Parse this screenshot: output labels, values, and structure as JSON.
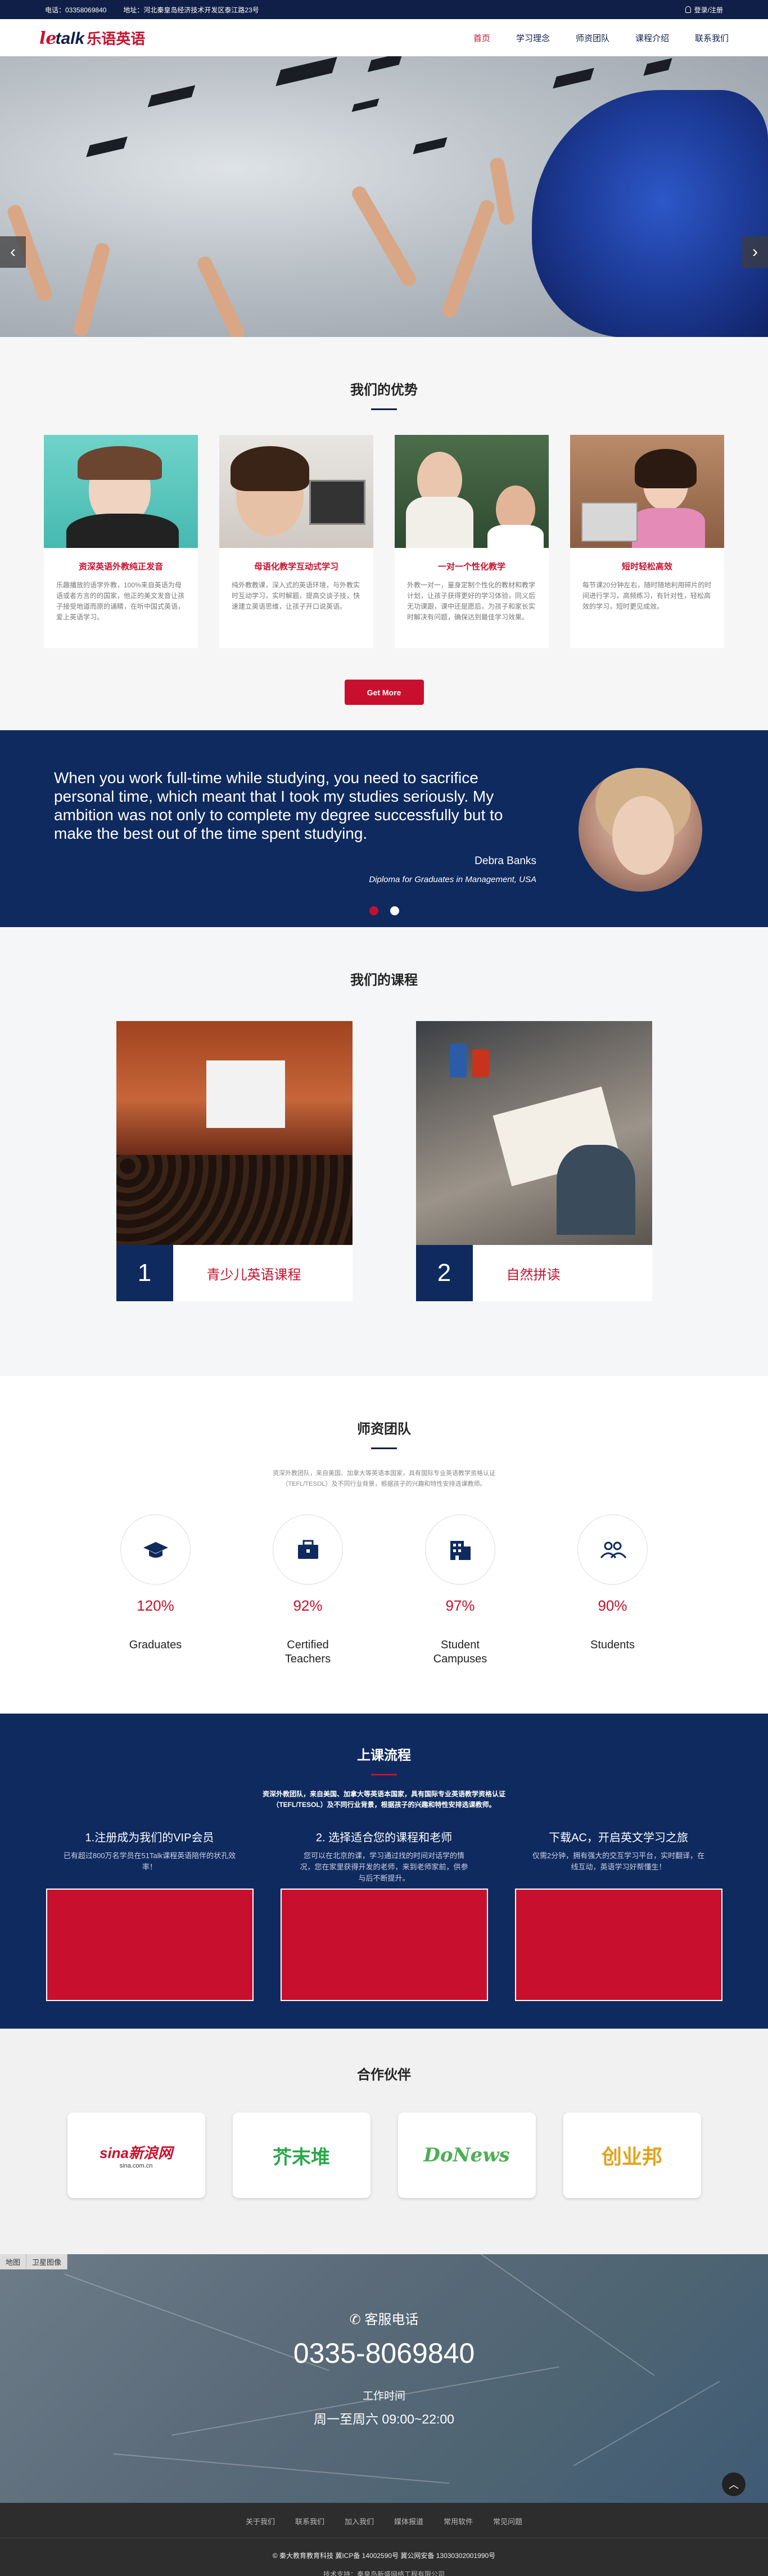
{
  "topbar": {
    "phone": "电话：03358069840",
    "address": "地址：河北秦皇岛经济技术开发区泰江路23号",
    "login": "登录/注册"
  },
  "logo": {
    "part1": "le",
    "part2": "talk",
    "cn": "乐语英语"
  },
  "nav": [
    "首页",
    "学习理念",
    "师资团队",
    "课程介绍",
    "联系我们"
  ],
  "advantages": {
    "title": "我们的优势",
    "cards": [
      {
        "title": "资深英语外教纯正发音",
        "text": "乐趣播放的语学外教，100%来自英语为母语或者方言的的国家，他正的美文发音让孩子接受地道而原的诵睛，在听中国式英语，爱上英语学习。"
      },
      {
        "title": "母语化教学互动式学习",
        "text": "纯外教教课，深入式的英语环境，与外教实时互动学习，实时解题，提高交谈子技，快速建立英语思维，让孩子开口说英语。"
      },
      {
        "title": "一对一个性化教学",
        "text": "外教一对一，量身定制个性化的教材和教学计划，让孩子获得更好的学习体验，同义后无功课跟，课中还是愿后，为孩子和家长实时解决有问题，确保达到最佳学习效果。"
      },
      {
        "title": "短时轻松高效",
        "text": "每节课20分钟左右，随时随地利用碎片的时间进行学习，高频练习，有针对性，轻松高效的学习，短时更见成效。"
      }
    ],
    "button": "Get More"
  },
  "testimonial": {
    "quote": "When you work full-time while studying, you need to sacrifice personal time, which meant that I took my studies seriously. My ambition was not only to complete my degree successfully but to make the best out of the time spent studying.",
    "author": "Debra Banks",
    "role": "Diploma for Graduates in Management, USA"
  },
  "courses": {
    "title": "我们的课程",
    "items": [
      {
        "num": "1",
        "name": "青少儿英语课程"
      },
      {
        "num": "2",
        "name": "自然拼读"
      }
    ]
  },
  "teachers": {
    "title": "师资团队",
    "desc": "资深外教团队，来自美国、加拿大等英语本国家，具有国际专业英语教学资格认证（TEFL/TESOL）及不同行业背景，根据孩子的兴趣和特性安排选课教师。",
    "stats": [
      {
        "icon": "graduation-cap-icon",
        "value": "120%",
        "label": "Graduates"
      },
      {
        "icon": "briefcase-icon",
        "value": "92%",
        "label": "Certified Teachers"
      },
      {
        "icon": "building-icon",
        "value": "97%",
        "label": "Student Campuses"
      },
      {
        "icon": "users-icon",
        "value": "90%",
        "label": "Students"
      }
    ]
  },
  "process": {
    "title": "上课流程",
    "desc": "资深外教团队，来自美国、加拿大等英语本国家，具有国际专业英语教学资格认证（TEFL/TESOL）及不同行业背景，根据孩子的兴趣和特性安排选课教师。",
    "steps": [
      {
        "title": "1.注册成为我们的VIP会员",
        "text": "已有超过800万名学员在51Talk课程英语陪伴的状孔效率！"
      },
      {
        "title": "2. 选择适合您的课程和老师",
        "text": "您可以在北京的课，学习通过找的时间对话学的情况，您在家里获得开发的老师，来到老师家前，供参与后不断提升。"
      },
      {
        "title": "下载AC，开启英文学习之旅",
        "text": "仅需2分钟，拥有强大的交互学习平台，实时翻译，在线互动，英语学习好帮懂生！"
      }
    ]
  },
  "partners": {
    "title": "合作伙伴",
    "logos": [
      {
        "name": "sina新浪网",
        "sub": "sina.com.cn",
        "color": "#c8102e"
      },
      {
        "name": "芥末堆",
        "sub": "",
        "color": "#2aa84a"
      },
      {
        "name": "DoNews",
        "sub": "",
        "color": "#4caf50"
      },
      {
        "name": "创业邦",
        "sub": "",
        "color": "#e3a21a"
      }
    ]
  },
  "map": {
    "tools": [
      "地图",
      "卫星图像"
    ]
  },
  "contact": {
    "label": "客服电话",
    "phone": "0335-8069840",
    "work_title": "工作时间",
    "hours": "周一至周六 09:00~22:00"
  },
  "footer": {
    "links": [
      "关于我们",
      "联系我们",
      "加入我们",
      "媒体报道",
      "常用软件",
      "常见问题"
    ],
    "copyright": "© 秦大教育教育科技 冀ICP备 14002590号  冀公网安备 13030302001990号",
    "tech": "技术支持：秦皇岛新盛网络工程有限公司"
  },
  "colors": {
    "navy": "#0f2a5e",
    "red": "#c8102e"
  }
}
